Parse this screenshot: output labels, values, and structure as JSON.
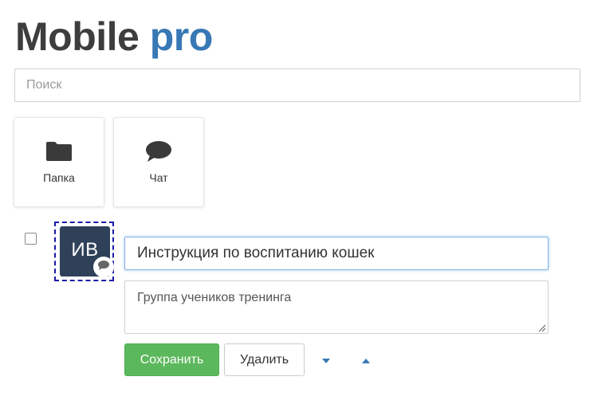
{
  "app": {
    "title_part1": "Mobile",
    "title_part2": "pro",
    "title_color_main": "#3d3d3d",
    "title_color_accent": "#3778b5"
  },
  "search": {
    "placeholder": "Поиск",
    "value": ""
  },
  "tiles": [
    {
      "label": "Папка",
      "icon": "folder-icon"
    },
    {
      "label": "Чат",
      "icon": "chat-bubble-icon"
    }
  ],
  "item": {
    "checked": false,
    "avatar_initials": "ИВ",
    "avatar_color": "#2e4159",
    "badge_icon": "chat-bubble-icon",
    "title_value": "Инструкция по воспитанию кошек",
    "description_value": "Группа учеников тренинга"
  },
  "actions": {
    "save_label": "Сохранить",
    "delete_label": "Удалить",
    "move_down_icon": "caret-down-icon",
    "move_up_icon": "caret-up-icon",
    "save_color": "#5cb85c",
    "arrow_color": "#3778b5"
  }
}
